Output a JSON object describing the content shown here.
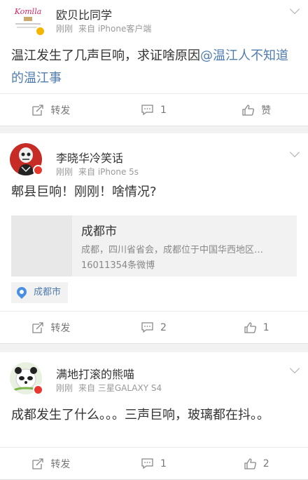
{
  "posts": [
    {
      "username": "欧贝比同学",
      "time": "刚刚",
      "source": "来自 iPhone客户端",
      "text": "温江发生了几声巨响，求证啥原因",
      "mention": "@温江人不知道的温江事",
      "avatar_text": "Komlla",
      "actions": {
        "repost": "转发",
        "comment": "1",
        "like": "赞"
      }
    },
    {
      "username": "李晓华冷笑话",
      "time": "刚刚",
      "source": "来自 iPhone 5s",
      "text": "郫县巨响！刚刚！啥情况?",
      "link_card": {
        "title": "成都市",
        "description": "成都，四川省省会，成都位于中国华西地区…",
        "subtitle": "16011354条微博"
      },
      "location": "成都市",
      "actions": {
        "repost": "转发",
        "comment": "2",
        "like": "1"
      }
    },
    {
      "username": "满地打滚的熊喵",
      "time": "刚刚",
      "source": "来自 三星GALAXY S4",
      "text": "成都发生了什么。。。三声巨响，玻璃都在抖。。",
      "actions": {
        "repost": "转发",
        "comment": "1",
        "like": "2"
      }
    }
  ],
  "colors": {
    "mention": "#507daf",
    "meta": "#999999",
    "background": "#f2f2f2",
    "verified_badge": "#f5b400",
    "red_badge": "#e8372f"
  },
  "icons": [
    "repost-icon",
    "comment-icon",
    "like-icon",
    "location-icon",
    "chevron-down-icon"
  ]
}
